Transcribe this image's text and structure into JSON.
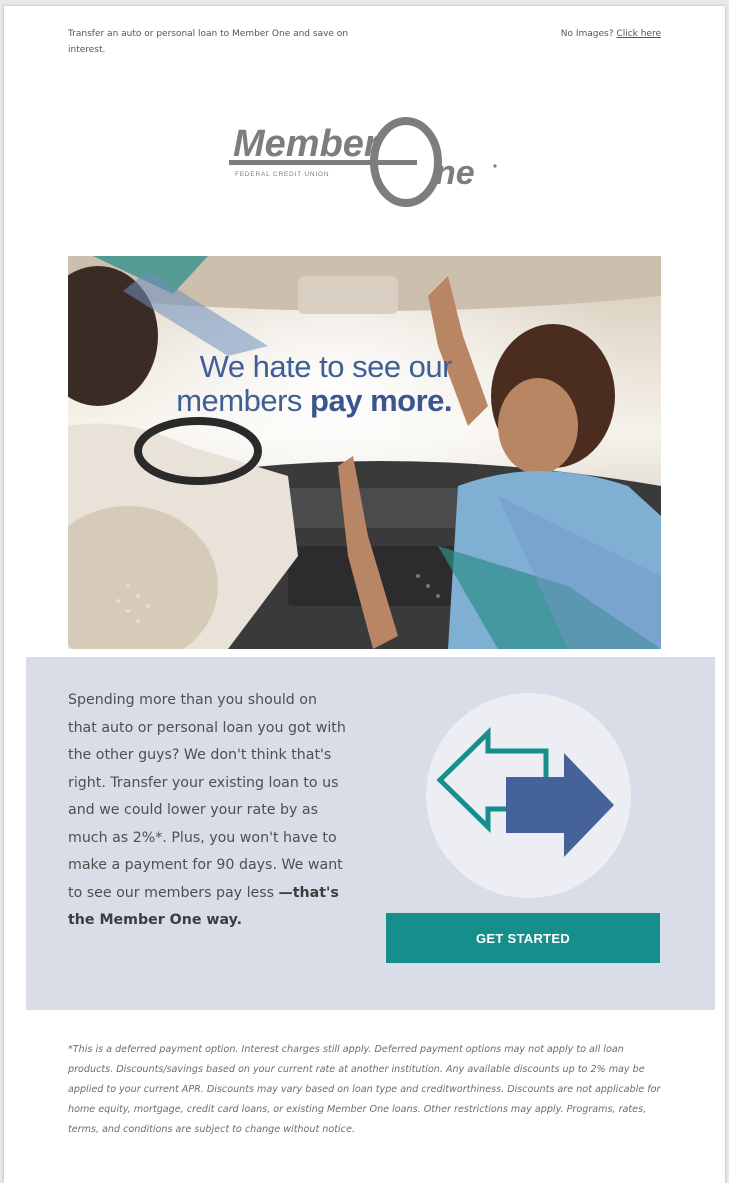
{
  "header": {
    "preheader_text": "Transfer an auto or personal loan to Member One and save on interest.",
    "no_images_label": "No Images?",
    "click_here_link": "Click here"
  },
  "logo": {
    "brand_word_1": "Member",
    "brand_word_2": "ne",
    "tagline": "FEDERAL CREDIT UNION"
  },
  "hero": {
    "headline_line1": "We hate to see our",
    "headline_line2_regular": "members ",
    "headline_line2_bold": "pay more."
  },
  "panel": {
    "body_text": "Spending more than you should on that auto or personal loan you got with the other guys? We don't think that's right. Transfer your existing loan to us and we could lower your rate by as much as 2%*. Plus, you won't have to make a payment for 90 days. We want to see our members pay less",
    "body_text_bold": "—that's the Member One way.",
    "icon": "transfer-arrows-icon",
    "cta_label": "GET STARTED"
  },
  "footer": {
    "disclaimer": "*This is a deferred payment option. Interest charges still apply. Deferred payment options may not apply to all loan products. Discounts/savings based on your current rate at another institution. Any available discounts up to 2% may be applied to your current APR. Discounts may vary based on loan type and creditworthiness. Discounts are not applicable for home equity, mortgage, credit card loans, or existing Member One loans. Other restrictions may apply. Programs, rates, terms, and conditions are subject to change without notice."
  },
  "colors": {
    "brand_blue": "#3f5f96",
    "teal": "#168e8c",
    "panel_bg": "#d8dde8",
    "arrow_blue": "#466399"
  }
}
